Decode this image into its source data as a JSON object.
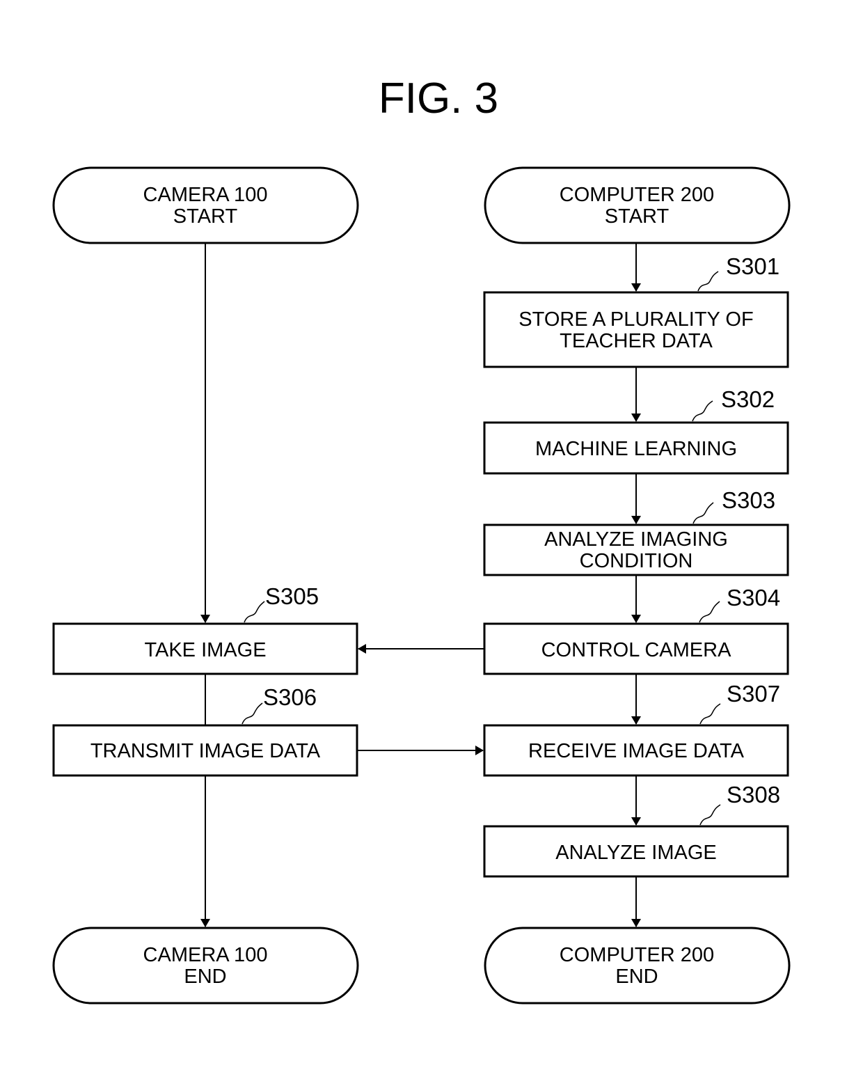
{
  "figure": {
    "title": "FIG. 3"
  },
  "camera_column": {
    "start": [
      "CAMERA 100",
      "START"
    ],
    "end": [
      "CAMERA 100",
      "END"
    ],
    "steps": [
      {
        "id": "S305",
        "lines": [
          "TAKE IMAGE"
        ]
      },
      {
        "id": "S306",
        "lines": [
          "TRANSMIT IMAGE DATA"
        ]
      }
    ]
  },
  "computer_column": {
    "start": [
      "COMPUTER 200",
      "START"
    ],
    "end": [
      "COMPUTER 200",
      "END"
    ],
    "steps": [
      {
        "id": "S301",
        "lines": [
          "STORE A PLURALITY OF",
          "TEACHER DATA"
        ]
      },
      {
        "id": "S302",
        "lines": [
          "MACHINE LEARNING"
        ]
      },
      {
        "id": "S303",
        "lines": [
          "ANALYZE IMAGING",
          "CONDITION"
        ]
      },
      {
        "id": "S304",
        "lines": [
          "CONTROL CAMERA"
        ]
      },
      {
        "id": "S307",
        "lines": [
          "RECEIVE IMAGE DATA"
        ]
      },
      {
        "id": "S308",
        "lines": [
          "ANALYZE IMAGE"
        ]
      }
    ]
  },
  "cross_flows": [
    {
      "from": "S304",
      "to": "S305"
    },
    {
      "from": "S306",
      "to": "S307"
    }
  ]
}
